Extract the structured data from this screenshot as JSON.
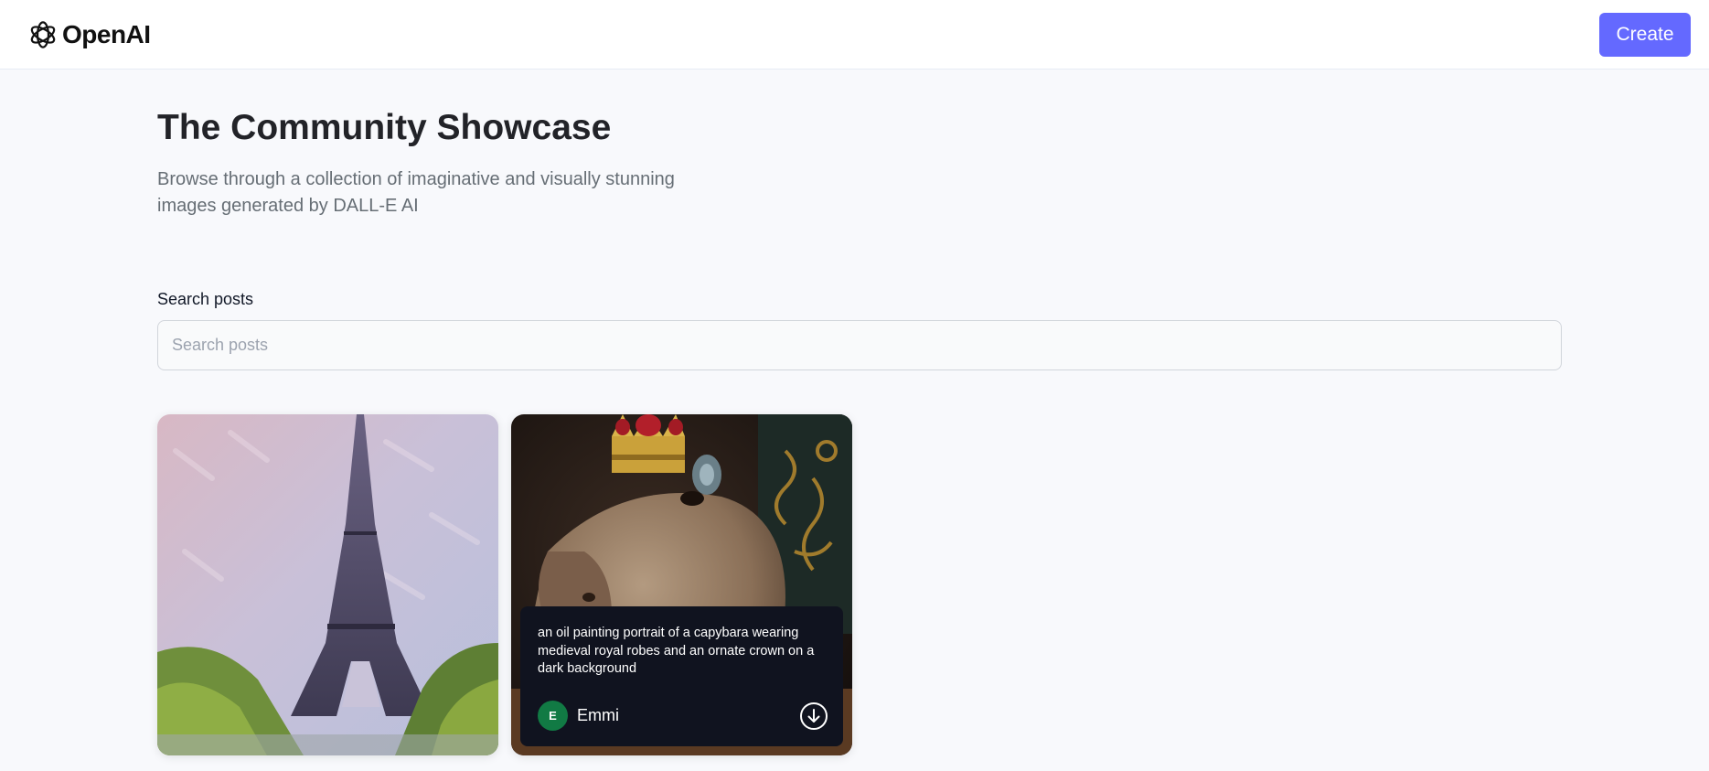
{
  "header": {
    "logo_text": "OpenAI",
    "create_label": "Create"
  },
  "hero": {
    "title": "The Community Showcase",
    "subtitle": "Browse through a collection of imaginative and visually stunning images generated by DALL-E AI"
  },
  "search": {
    "label": "Search posts",
    "placeholder": "Search posts",
    "value": ""
  },
  "posts": [
    {
      "image": "eiffel-tower-painting",
      "prompt": "",
      "author": ""
    },
    {
      "image": "capybara-crown-painting",
      "prompt": "an oil painting portrait of a capybara wearing medieval royal robes and an ornate crown on a dark background",
      "author": "Emmi",
      "author_initial": "E",
      "download_icon": "download-icon"
    }
  ],
  "colors": {
    "accent": "#6469ff",
    "page_background": "#f8f9fc",
    "overlay_background": "#10131f",
    "avatar_background": "#117a44"
  }
}
